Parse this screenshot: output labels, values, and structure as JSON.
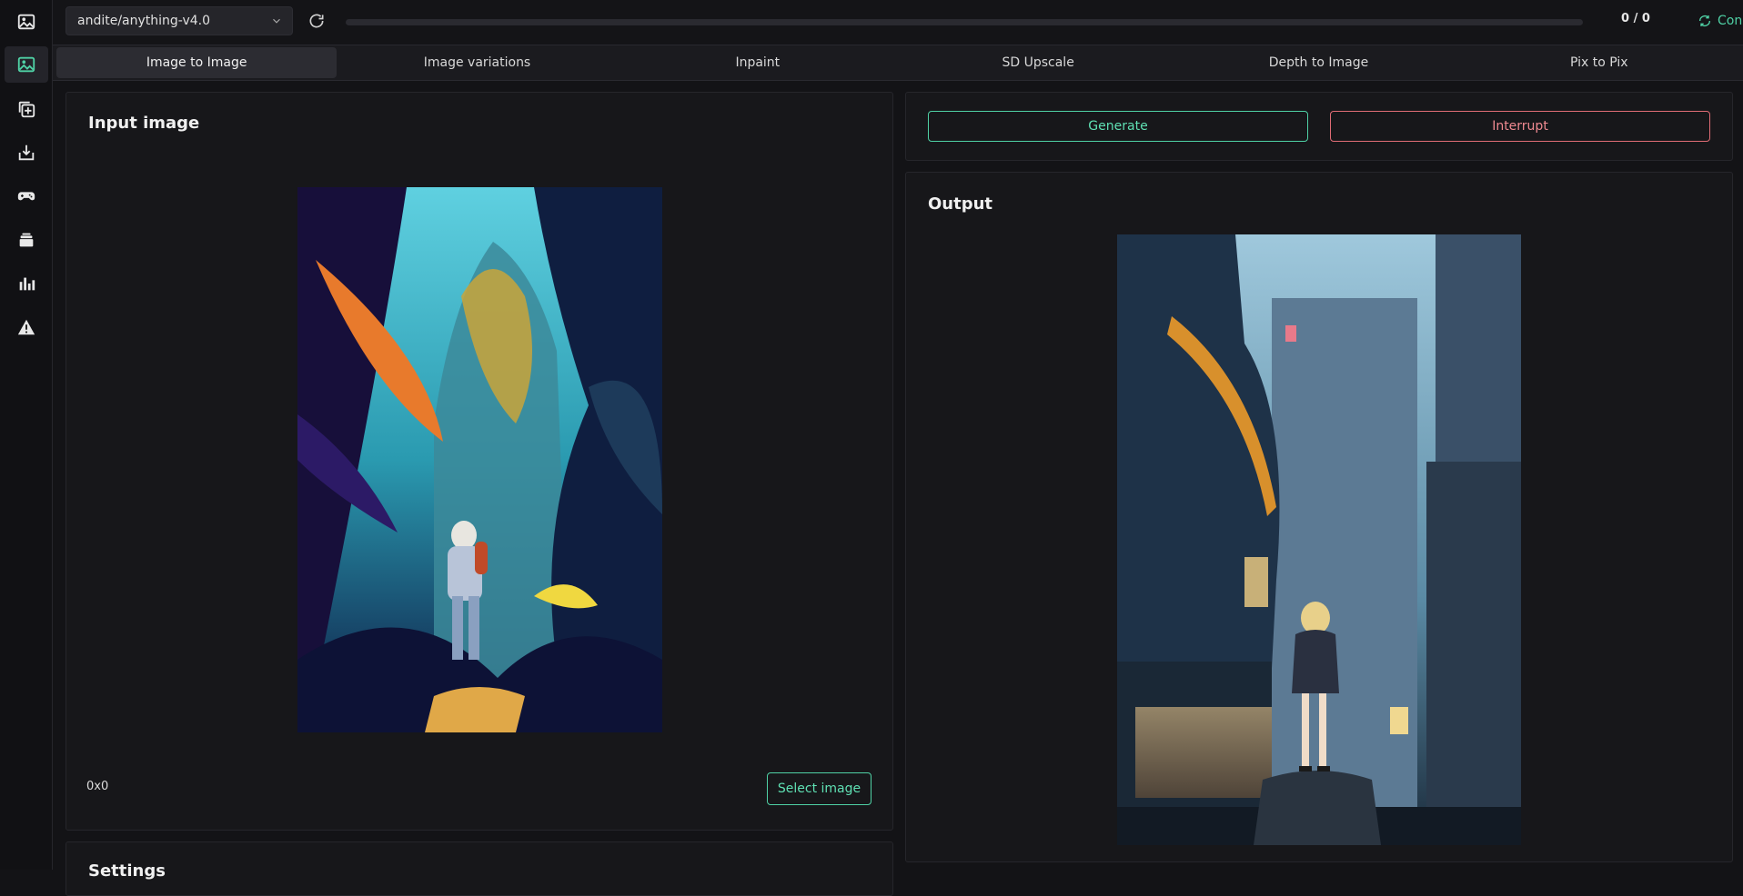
{
  "toolbar": {
    "model": "andite/anything-v4.0",
    "progress_text": "0 / 0",
    "progress_fraction": 0,
    "status": "Connected"
  },
  "tabs": [
    {
      "label": "Image to Image"
    },
    {
      "label": "Image variations"
    },
    {
      "label": "Inpaint"
    },
    {
      "label": "SD Upscale"
    },
    {
      "label": "Depth to Image"
    },
    {
      "label": "Pix to Pix"
    }
  ],
  "sidebar": {
    "icons": [
      "image-icon",
      "image-to-image-icon",
      "add-layer-icon",
      "download-icon",
      "gamepad-icon",
      "layers-icon",
      "bar-chart-icon",
      "warning-icon"
    ]
  },
  "input_panel": {
    "title": "Input image",
    "dimensions": "0x0",
    "select_label": "Select image"
  },
  "actions": {
    "generate_label": "Generate",
    "interrupt_label": "Interrupt"
  },
  "output_panel": {
    "title": "Output"
  },
  "settings_panel": {
    "title": "Settings"
  },
  "colors": {
    "accent": "#4fd1a5",
    "danger": "#e06c75",
    "background": "#131316"
  }
}
